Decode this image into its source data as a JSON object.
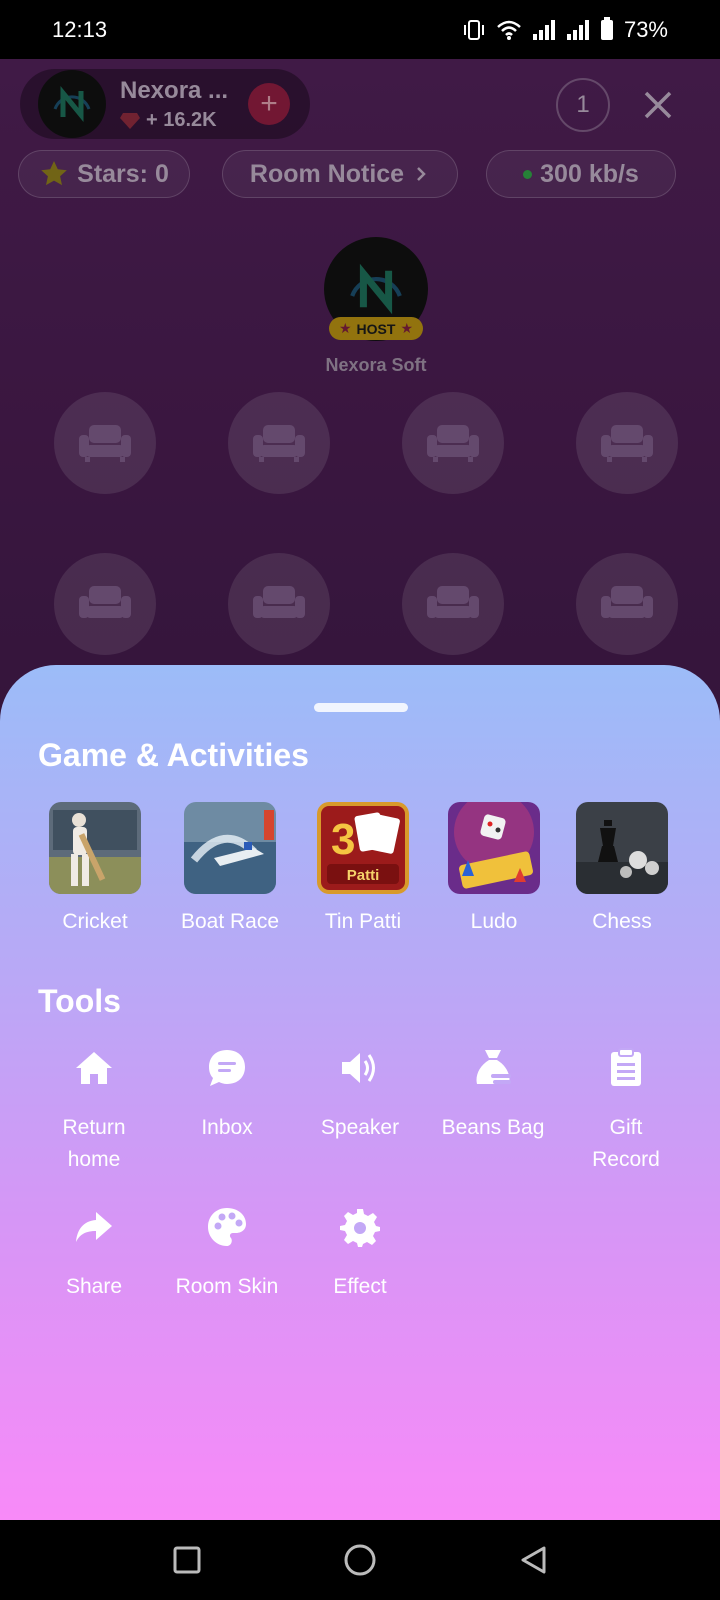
{
  "status_bar": {
    "time": "12:13",
    "battery": "73%"
  },
  "room": {
    "host_name": "Nexora ...",
    "host_stat": "+ 16.2K",
    "viewer_count": "1",
    "stars_label": "Stars: 0",
    "notice_label": "Room Notice",
    "speed_label": "300 kb/s",
    "host_badge": "HOST",
    "host_seat_name": "Nexora Soft"
  },
  "sheet": {
    "games_title": "Game & Activities",
    "games": [
      {
        "label": "Cricket",
        "icon": "cricket-thumbnail"
      },
      {
        "label": "Boat Race",
        "icon": "boat-race-thumbnail"
      },
      {
        "label": "Tin Patti",
        "icon": "tin-patti-thumbnail",
        "thumb_text": "Patti"
      },
      {
        "label": "Ludo",
        "icon": "ludo-thumbnail"
      },
      {
        "label": "Chess",
        "icon": "chess-thumbnail"
      }
    ],
    "tools_title": "Tools",
    "tools": [
      {
        "label": "Return home",
        "icon": "home-icon"
      },
      {
        "label": "Inbox",
        "icon": "chat-bubble-icon"
      },
      {
        "label": "Speaker",
        "icon": "speaker-icon"
      },
      {
        "label": "Beans Bag",
        "icon": "bag-icon"
      },
      {
        "label": "Gift Record",
        "icon": "clipboard-icon"
      },
      {
        "label": "Share",
        "icon": "share-arrow-icon"
      },
      {
        "label": "Room Skin",
        "icon": "palette-icon"
      },
      {
        "label": "Effect",
        "icon": "gear-icon"
      }
    ]
  },
  "colors": {
    "sheet_top": "#9cbcf8",
    "sheet_bottom": "#f88af8",
    "room_bg": "#4f2056",
    "host_badge": "#b38d12"
  }
}
